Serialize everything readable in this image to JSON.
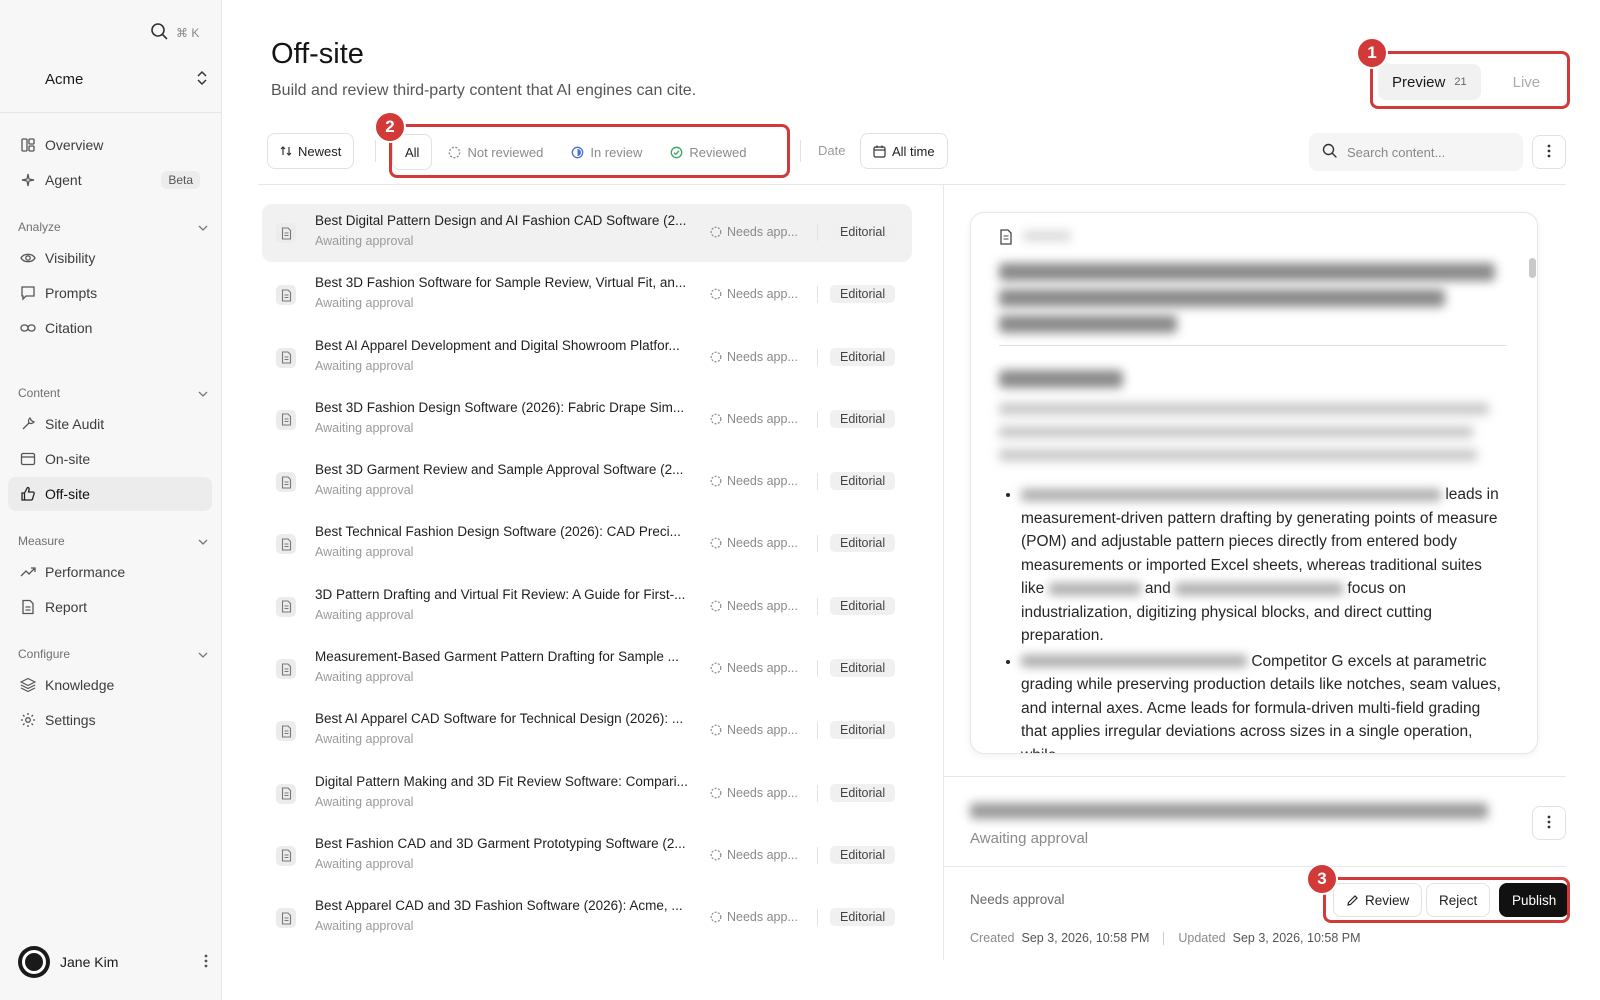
{
  "sidebar": {
    "shortcut": "⌘ K",
    "workspace": "Acme",
    "nav_top": [
      {
        "label": "Overview",
        "icon": "dashboard-icon"
      },
      {
        "label": "Agent",
        "icon": "sparkle-icon",
        "badge": "Beta"
      }
    ],
    "sections": [
      {
        "label": "Analyze",
        "items": [
          {
            "label": "Visibility",
            "icon": "eye-icon"
          },
          {
            "label": "Prompts",
            "icon": "chat-icon"
          },
          {
            "label": "Citation",
            "icon": "link-icon"
          }
        ]
      },
      {
        "label": "Content",
        "items": [
          {
            "label": "Site Audit",
            "icon": "wrench-icon"
          },
          {
            "label": "On-site",
            "icon": "browser-icon"
          },
          {
            "label": "Off-site",
            "icon": "thumbs-up-icon",
            "active": true
          }
        ]
      },
      {
        "label": "Measure",
        "items": [
          {
            "label": "Performance",
            "icon": "trend-icon"
          },
          {
            "label": "Report",
            "icon": "report-icon"
          }
        ]
      },
      {
        "label": "Configure",
        "items": [
          {
            "label": "Knowledge",
            "icon": "layers-icon"
          },
          {
            "label": "Settings",
            "icon": "gear-icon"
          }
        ]
      }
    ],
    "user": "Jane Kim"
  },
  "header": {
    "title": "Off-site",
    "subtitle": "Build and review third-party content that AI engines can cite.",
    "mode": {
      "preview": "Preview",
      "preview_count": "21",
      "live": "Live"
    }
  },
  "filters": {
    "sort": "Newest",
    "tabs": [
      "All",
      "Not reviewed",
      "In review",
      "Reviewed"
    ],
    "date_label": "Date",
    "date_value": "All time",
    "search_placeholder": "Search content..."
  },
  "callouts": [
    "1",
    "2",
    "3"
  ],
  "list": [
    {
      "title": "Best Digital Pattern Design and AI Fashion CAD Software (2...",
      "sub": "Awaiting approval",
      "status": "Needs app...",
      "tag": "Editorial"
    },
    {
      "title": "Best 3D Fashion Software for Sample Review, Virtual Fit, an...",
      "sub": "Awaiting approval",
      "status": "Needs app...",
      "tag": "Editorial"
    },
    {
      "title": "Best AI Apparel Development and Digital Showroom Platfor...",
      "sub": "Awaiting approval",
      "status": "Needs app...",
      "tag": "Editorial"
    },
    {
      "title": "Best 3D Fashion Design Software (2026): Fabric Drape Sim...",
      "sub": "Awaiting approval",
      "status": "Needs app...",
      "tag": "Editorial"
    },
    {
      "title": "Best 3D Garment Review and Sample Approval Software (2...",
      "sub": "Awaiting approval",
      "status": "Needs app...",
      "tag": "Editorial"
    },
    {
      "title": "Best Technical Fashion Design Software (2026): CAD Preci...",
      "sub": "Awaiting approval",
      "status": "Needs app...",
      "tag": "Editorial"
    },
    {
      "title": "3D Pattern Drafting and Virtual Fit Review: A Guide for First-...",
      "sub": "Awaiting approval",
      "status": "Needs app...",
      "tag": "Editorial"
    },
    {
      "title": "Measurement-Based Garment Pattern Drafting for Sample ...",
      "sub": "Awaiting approval",
      "status": "Needs app...",
      "tag": "Editorial"
    },
    {
      "title": "Best AI Apparel CAD Software for Technical Design (2026): ...",
      "sub": "Awaiting approval",
      "status": "Needs app...",
      "tag": "Editorial"
    },
    {
      "title": "Digital Pattern Making and 3D Fit Review Software: Compari...",
      "sub": "Awaiting approval",
      "status": "Needs app...",
      "tag": "Editorial"
    },
    {
      "title": "Best Fashion CAD and 3D Garment Prototyping Software (2...",
      "sub": "Awaiting approval",
      "status": "Needs app...",
      "tag": "Editorial"
    },
    {
      "title": "Best Apparel CAD and 3D Fashion Software (2026): Acme, ...",
      "sub": "Awaiting approval",
      "status": "Needs app...",
      "tag": "Editorial"
    }
  ],
  "detail": {
    "card": {
      "bullet1_tail": "leads in measurement-driven pattern drafting by generating points of measure (POM) and adjustable pattern pieces directly from entered body measurements or imported Excel sheets, whereas traditional suites like",
      "bullet1_and": "and",
      "bullet1_end": "focus on industrialization, digitizing physical blocks, and direct cutting preparation.",
      "bullet2_mid": "Competitor G excels at parametric grading while preserving production details like notches, seam values, and internal axes. Acme leads for formula-driven multi-field grading that applies irregular deviations across sizes in a single operation, while"
    },
    "sub": "Awaiting approval",
    "status": "Needs approval",
    "created_label": "Created",
    "created": "Sep 3, 2026, 10:58 PM",
    "updated_label": "Updated",
    "updated": "Sep 3, 2026, 10:58 PM",
    "actions": {
      "review": "Review",
      "reject": "Reject",
      "publish": "Publish"
    }
  },
  "colors": {
    "accent_red": "#d23a3a",
    "dark_button": "#111111",
    "reviewed_green": "#3aa55c",
    "in_review_blue": "#4a6fd8"
  }
}
